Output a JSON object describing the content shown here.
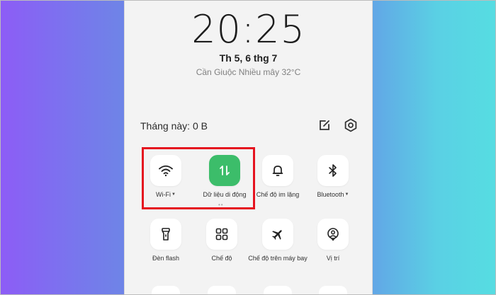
{
  "lockscreen": {
    "time": "20:25",
    "date": "Th 5, 6 thg 7",
    "weather": "Cần Giuộc Nhiều mây 32°C"
  },
  "quick_settings": {
    "usage_label": "Tháng này: 0 B",
    "edit_icon": "edit-icon",
    "settings_icon": "settings-icon",
    "tiles": [
      {
        "label": "Wi-Fi",
        "icon": "wifi-icon",
        "active": false,
        "has_caret": true
      },
      {
        "label": "Dữ liệu di động",
        "icon": "mobile-data-icon",
        "active": true,
        "has_caret": false
      },
      {
        "label": "Chế độ im lặng",
        "icon": "bell-icon",
        "active": false,
        "has_caret": false
      },
      {
        "label": "Bluetooth",
        "icon": "bluetooth-icon",
        "active": false,
        "has_caret": true
      },
      {
        "label": "Đèn flash",
        "icon": "flashlight-icon",
        "active": false,
        "has_caret": false
      },
      {
        "label": "Chế độ",
        "icon": "modes-icon",
        "active": false,
        "has_caret": false
      },
      {
        "label": "Chế độ trên máy bay",
        "icon": "airplane-icon",
        "active": false,
        "has_caret": false
      },
      {
        "label": "Vị trí",
        "icon": "location-icon",
        "active": false,
        "has_caret": false
      }
    ]
  },
  "colors": {
    "active_tile": "#3cbd6a",
    "highlight_box": "#e5131f",
    "panel_bg": "#f3f3f3"
  }
}
